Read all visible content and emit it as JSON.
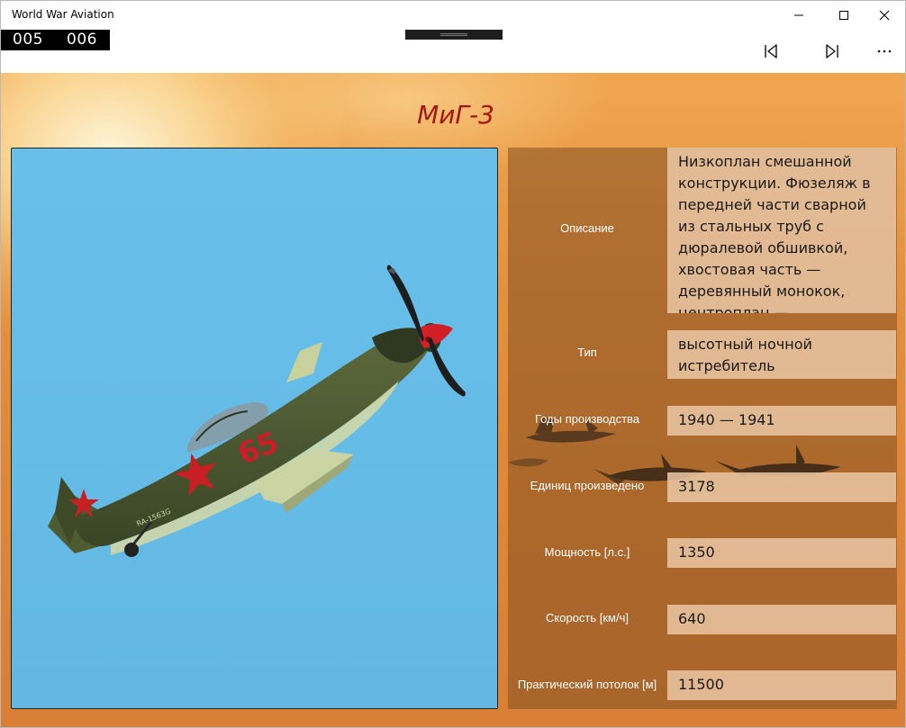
{
  "window": {
    "title": "World War Aviation",
    "controls": {
      "minimize_icon": "minimize-icon",
      "maximize_icon": "maximize-icon",
      "close_icon": "close-icon"
    }
  },
  "counter": {
    "current": "005",
    "total": "006"
  },
  "toolbar": {
    "first_icon": "skip-back-icon",
    "next_icon": "skip-forward-icon",
    "more_icon": "more-icon"
  },
  "aircraft": {
    "name": "МиГ-3",
    "photo_icon": "aircraft-photo"
  },
  "fields": {
    "description": {
      "label": "Описание",
      "value": "Низкоплан смешанной конструкции. Фюзеляж в передней части сварной из стальных труб с дюралевой обшивкой, хвостовая часть — деревянный монокок, центроплан —"
    },
    "type": {
      "label": "Тип",
      "value": "высотный ночной истребитель"
    },
    "years": {
      "label": "Годы производства",
      "value": "1940 — 1941"
    },
    "units": {
      "label": "Единиц произведено",
      "value": "3178"
    },
    "power": {
      "label": "Мощность [л.с.]",
      "value": "1350"
    },
    "speed": {
      "label": "Скорость [км/ч]",
      "value": "640"
    },
    "ceiling": {
      "label": "Практический потолок [м]",
      "value": "11500"
    }
  },
  "colors": {
    "title_red": "#a61612",
    "sky_blue": "#66bde6",
    "background_orange": "#e58f3d"
  }
}
